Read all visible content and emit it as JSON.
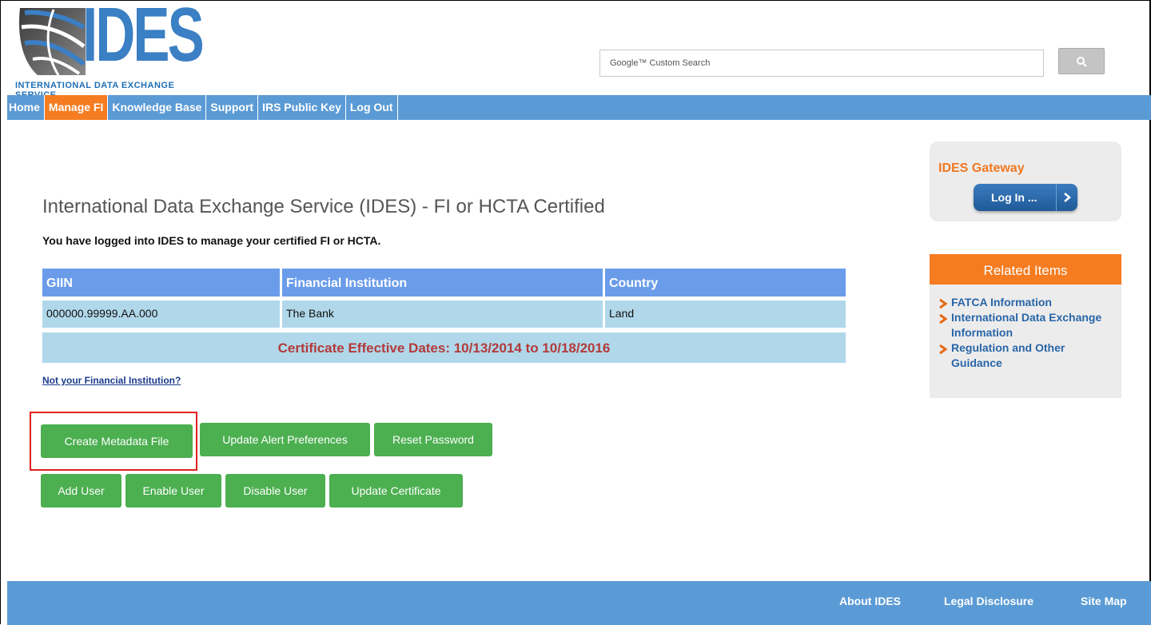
{
  "header": {
    "logo_text": "IDES",
    "logo_subtitle": "INTERNATIONAL DATA EXCHANGE SERVICE",
    "search_placeholder": "Google™ Custom Search",
    "search_icon": "search-icon"
  },
  "nav": {
    "items": [
      {
        "label": "Home",
        "active": false
      },
      {
        "label": "Manage FI",
        "active": true
      },
      {
        "label": "Knowledge Base",
        "active": false
      },
      {
        "label": "Support",
        "active": false
      },
      {
        "label": "IRS Public Key",
        "active": false
      },
      {
        "label": "Log Out",
        "active": false
      }
    ]
  },
  "main": {
    "title": "International Data Exchange Service (IDES) - FI or HCTA Certified",
    "subtitle": "You have logged into IDES to manage your certified FI or HCTA.",
    "table": {
      "headers": [
        "GIIN",
        "Financial Institution",
        "Country"
      ],
      "rows": [
        [
          "000000.99999.AA.000",
          "The Bank",
          "Land"
        ]
      ],
      "certificate": "Certificate Effective Dates: 10/13/2014 to 10/18/2016"
    },
    "not_your_fi": "Not your Financial Institution?",
    "buttons_row1": [
      "Create Metadata File",
      "Update Alert Preferences",
      "Reset Password"
    ],
    "buttons_row2": [
      "Add User",
      "Enable User",
      "Disable User",
      "Update Certificate"
    ]
  },
  "sidebar": {
    "gateway_title": "IDES Gateway",
    "login_label": "Log In ...",
    "related_title": "Related Items",
    "related_items": [
      "FATCA Information",
      "International Data Exchange Information",
      "Regulation and Other Guidance"
    ]
  },
  "footer": {
    "links": [
      "About IDES",
      "Legal Disclosure",
      "Site Map"
    ]
  },
  "colors": {
    "nav_blue": "#5b9bd5",
    "active_orange": "#f57c20",
    "button_green": "#4caf50",
    "table_header": "#6a9cea",
    "table_cell": "#b0d8ea",
    "cert_text": "#b23a3a",
    "highlight_red": "#e02020"
  }
}
